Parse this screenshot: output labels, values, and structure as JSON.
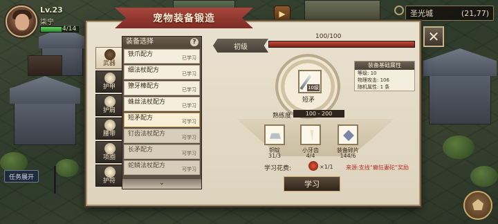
{
  "hud": {
    "level": "Lv.23",
    "player_name": "柒宁",
    "hp_text": "4/14",
    "hp_fraction": 0.55
  },
  "location": {
    "name": "圣光城",
    "coords": "(21,77)"
  },
  "task_button": "任务展开",
  "dialog": {
    "title": "宠物装备锻造",
    "close_label": "✕"
  },
  "tabs": [
    {
      "label": "武器",
      "icon": "weapon-icon",
      "active": true
    },
    {
      "label": "护甲",
      "icon": "armor-icon",
      "active": false
    },
    {
      "label": "护肩",
      "icon": "shoulder-icon",
      "active": false
    },
    {
      "label": "腰带",
      "icon": "belt-icon",
      "active": false
    },
    {
      "label": "项圈",
      "icon": "collar-icon",
      "active": false
    },
    {
      "label": "护符",
      "icon": "amulet-icon",
      "active": false
    }
  ],
  "recipe_list": {
    "header": "装备选择",
    "help": "?",
    "more": "⌄",
    "items": [
      {
        "name": "铁爪配方",
        "status": "已学习",
        "state": "learned"
      },
      {
        "name": "细法杖配方",
        "status": "已学习",
        "state": "learned"
      },
      {
        "name": "獠牙棒配方",
        "status": "已学习",
        "state": "learned"
      },
      {
        "name": "蛛丝法杖配方",
        "status": "已学习",
        "state": "learned"
      },
      {
        "name": "短矛配方",
        "status": "可学习",
        "state": "selected"
      },
      {
        "name": "钉齿法杖配方",
        "status": "可学习",
        "state": "locked"
      },
      {
        "name": "长矛配方",
        "status": "可学习",
        "state": "locked"
      },
      {
        "name": "蛇鳞法杖配方",
        "status": "可学习",
        "state": "locked"
      }
    ]
  },
  "level": {
    "label": "初级",
    "exp_text": "100/100",
    "exp_fraction": 1.0
  },
  "item": {
    "name": "短矛",
    "level_badge": "10级"
  },
  "attributes": {
    "header": "装备基础属性",
    "rows": [
      "等级: 10",
      "物理攻击: 106",
      "随机属性: 1 条"
    ]
  },
  "proficiency": {
    "label": "熟练度",
    "value": "100 - 200"
  },
  "materials": [
    {
      "name": "铜锭",
      "count": "31/3",
      "icon": "ingot-icon",
      "color": "#b8c0c8"
    },
    {
      "name": "小牙齿",
      "count": "4/4",
      "icon": "tooth-icon",
      "color": "#e8e0c8"
    },
    {
      "name": "装备碎片",
      "count": "144/6",
      "icon": "shard-icon",
      "color": "#7a86a8"
    }
  ],
  "cost": {
    "label": "学习花费:",
    "value": "×1/1",
    "icon": "gem-icon"
  },
  "source": "来源:支线“癫狂妻砣”奖励",
  "learn_button": "学习",
  "colors": {
    "title_banner": "#a7463c",
    "exp_bar": "#c04a3c",
    "source_text": "#b0322a"
  }
}
